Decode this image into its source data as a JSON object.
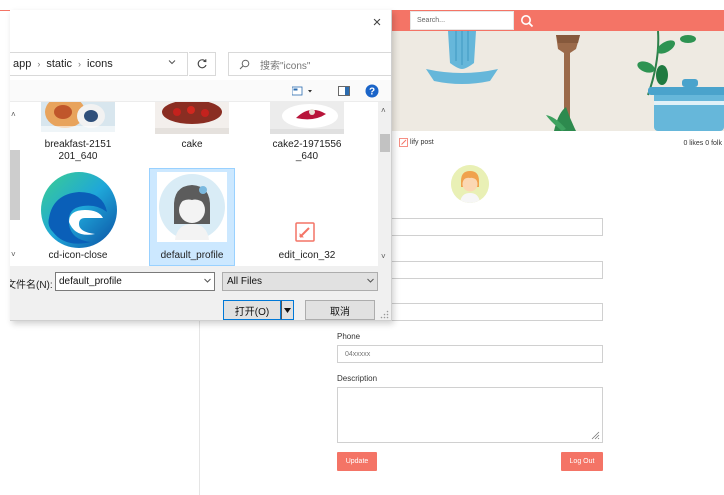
{
  "web": {
    "search_placeholder": "Search...",
    "nav_link": "lify post",
    "stats": "0 likes  0 folk",
    "field_partial": "n",
    "phone_label": "Phone",
    "phone_value": "04xxxxx",
    "description_label": "Description",
    "update_label": "Update",
    "logout_label": "Log Out",
    "accent_color": "#f47466"
  },
  "dialog": {
    "close_glyph": "×",
    "breadcrumb": [
      "app",
      "static",
      "icons"
    ],
    "search_placeholder": "搜索\"icons\"",
    "files": [
      {
        "name": "breakfast-2151201_640",
        "line1": "breakfast-2151",
        "line2": "201_640"
      },
      {
        "name": "cake",
        "line1": "cake",
        "line2": ""
      },
      {
        "name": "cake2-1971556_640",
        "line1": "cake2-1971556",
        "line2": "_640"
      },
      {
        "name": "cd-icon-close",
        "line1": "cd-icon-close",
        "line2": ""
      },
      {
        "name": "default_profile",
        "line1": "default_profile",
        "line2": ""
      },
      {
        "name": "edit_icon_32",
        "line1": "edit_icon_32",
        "line2": ""
      }
    ],
    "filename_label": "文件名(N):",
    "filename_value": "default_profile",
    "filetype_value": "All Files",
    "open_label": "打开(O)",
    "cancel_label": "取消",
    "selected_file": "default_profile"
  }
}
